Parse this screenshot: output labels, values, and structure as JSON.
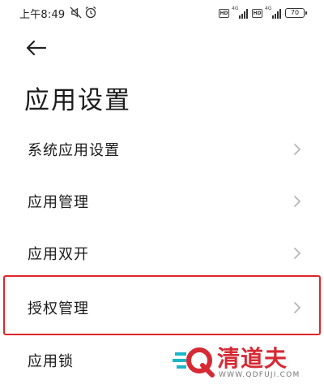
{
  "status_bar": {
    "time": "上午8:49",
    "battery": "70",
    "network_1": "4G",
    "network_2": "4G",
    "hd_1": "HD",
    "hd_2": "HD"
  },
  "header": {
    "back_icon": "arrow-left-icon",
    "title": "应用设置"
  },
  "list": {
    "items": [
      {
        "label": "系统应用设置"
      },
      {
        "label": "应用管理"
      },
      {
        "label": "应用双开"
      },
      {
        "label": "授权管理",
        "highlighted": true
      },
      {
        "label": "应用锁"
      }
    ]
  },
  "watermark": {
    "brand": "清道夫",
    "url": "WWW.QDFUJI.COM"
  },
  "colors": {
    "highlight": "#e0262a",
    "watermark_red": "#d62a34",
    "watermark_cyan": "#19b6c9"
  }
}
